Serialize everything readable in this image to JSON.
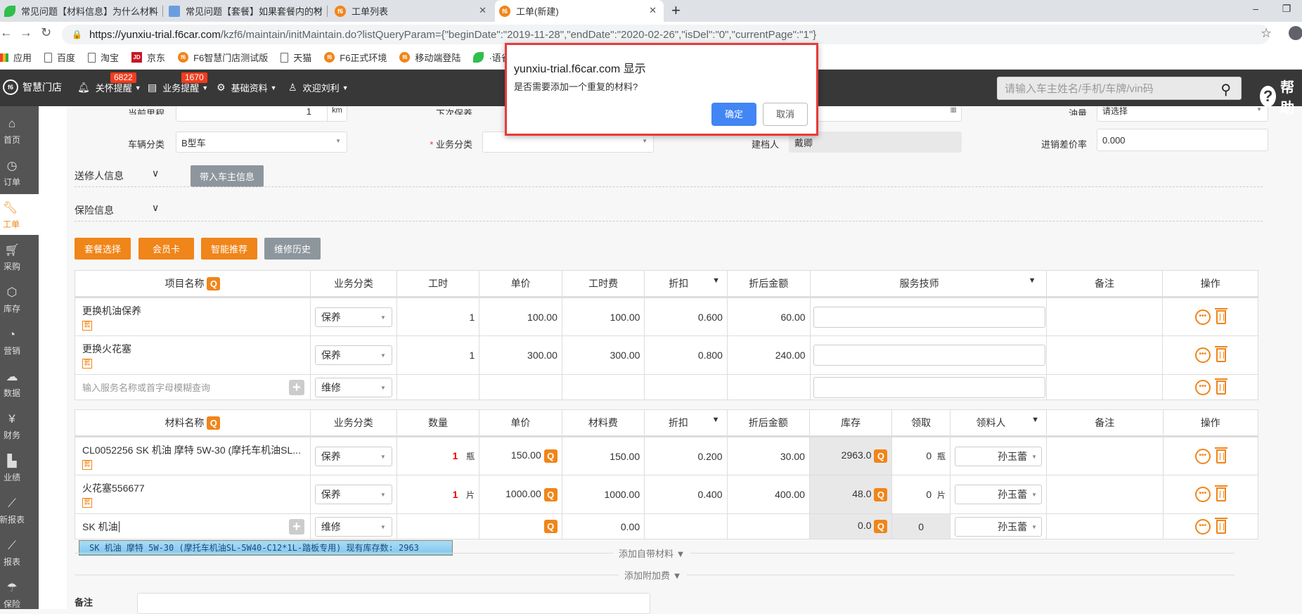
{
  "browser": {
    "tabs": [
      {
        "title": "常见问题【材料信息】为什么材料",
        "icon": "bird-icon"
      },
      {
        "title": "常见问题【套餐】如果套餐内的材",
        "icon": "doc-icon"
      },
      {
        "title": "工单列表",
        "icon": "f6-icon"
      },
      {
        "title": "工单(新建)",
        "icon": "f6-icon",
        "active": true
      }
    ],
    "new_tab": "+",
    "url_host": "https://yunxiu-trial.f6car.com",
    "url_rest": "/kzf6/maintain/initMaintain.do?listQueryParam={\"beginDate\":\"2019-11-28\",\"endDate\":\"2020-02-26\",\"isDel\":\"0\",\"currentPage\":\"1\"}",
    "bookmarks": [
      {
        "label": "应用",
        "icon": "apps"
      },
      {
        "label": "百度",
        "icon": "page"
      },
      {
        "label": "淘宝",
        "icon": "page"
      },
      {
        "label": "京东",
        "icon": "jd"
      },
      {
        "label": "F6智慧门店测试版",
        "icon": "f6"
      },
      {
        "label": "天猫",
        "icon": "page"
      },
      {
        "label": "F6正式环境",
        "icon": "f6"
      },
      {
        "label": "移动端登陆",
        "icon": "f6"
      },
      {
        "label": "·语雀数",
        "icon": "bird"
      }
    ]
  },
  "nav": {
    "logo": "智慧门店",
    "items": [
      {
        "label": "关怀提醒",
        "badge": "6822"
      },
      {
        "label": "业务提醒",
        "badge": "1670"
      },
      {
        "label": "基础资料"
      },
      {
        "label": "欢迎刘利"
      }
    ],
    "search_placeholder": "请输入车主姓名/手机/车牌/vin码",
    "help": "帮助"
  },
  "sidebar": [
    {
      "label": "首页",
      "icon": "home-icon"
    },
    {
      "label": "订单",
      "icon": "history-icon"
    },
    {
      "label": "工单",
      "icon": "wrench-icon",
      "active": true
    },
    {
      "label": "采购",
      "icon": "cart-icon"
    },
    {
      "label": "库存",
      "icon": "box-icon"
    },
    {
      "label": "营销",
      "icon": "pie-icon"
    },
    {
      "label": "数据",
      "icon": "cloud-icon"
    },
    {
      "label": "财务",
      "icon": "yuan-icon"
    },
    {
      "label": "业绩",
      "icon": "bar-chart-icon"
    },
    {
      "label": "新报表",
      "icon": "line-chart-icon"
    },
    {
      "label": "报表",
      "icon": "line-chart-icon"
    },
    {
      "label": "保险",
      "icon": "umbrella-icon"
    }
  ],
  "form": {
    "mileage_label": "当前里程",
    "mileage_value": "1",
    "mileage_unit": "km",
    "next_service_label": "下次保养",
    "oil_label": "油量",
    "oil_value": "请选择",
    "vehicle_class_label": "车辆分类",
    "vehicle_class_value": "B型车",
    "business_class_label": "业务分类",
    "business_class_value": "",
    "creator_label": "建档人",
    "creator_value": "戴卿",
    "margin_label": "进销差价率",
    "margin_value": "0.000",
    "sender_section": "送修人信息",
    "bring_owner_button": "带入车主信息",
    "insurance_section": "保险信息"
  },
  "actions": [
    "套餐选择",
    "会员卡",
    "智能推荐",
    "维修历史"
  ],
  "services": {
    "headers": [
      "项目名称",
      "业务分类",
      "工时",
      "单价",
      "工时费",
      "折扣",
      "折后金额",
      "服务技师",
      "备注",
      "操作"
    ],
    "rows": [
      {
        "name": "更换机油保养",
        "tag": "套",
        "category": "保养",
        "hours": "1",
        "price": "100.00",
        "fee": "100.00",
        "discount": "0.600",
        "amount": "60.00"
      },
      {
        "name": "更换火花塞",
        "tag": "套",
        "category": "保养",
        "hours": "1",
        "price": "300.00",
        "fee": "300.00",
        "discount": "0.800",
        "amount": "240.00"
      }
    ],
    "new_row_placeholder": "输入服务名称或首字母模糊查询",
    "new_row_category": "维修"
  },
  "materials": {
    "headers": [
      "材料名称",
      "业务分类",
      "数量",
      "单价",
      "材料费",
      "折扣",
      "折后金额",
      "库存",
      "领取",
      "领料人",
      "备注",
      "操作"
    ],
    "rows": [
      {
        "name": "CL0052256 SK 机油 摩特 5W-30 (摩托车机油SL...",
        "tag": "套",
        "category": "保养",
        "qty": "1",
        "unit": "瓶",
        "price": "150.00",
        "fee": "150.00",
        "discount": "0.200",
        "amount": "30.00",
        "stock": "2963.0",
        "taken": "0",
        "taken_unit": "瓶",
        "picker": "孙玉蕾"
      },
      {
        "name": "火花塞556677",
        "tag": "套",
        "category": "保养",
        "qty": "1",
        "unit": "片",
        "price": "1000.00",
        "fee": "1000.00",
        "discount": "0.400",
        "amount": "400.00",
        "stock": "48.0",
        "taken": "0",
        "taken_unit": "片",
        "picker": "孙玉蕾"
      }
    ],
    "new_row_input": "SK 机油",
    "new_row_category": "维修",
    "new_row_fee": "0.00",
    "new_row_stock": "0.0",
    "new_row_taken": "0",
    "new_row_picker": "孙玉蕾",
    "suggestion": "SK 机油 摩特 5W-30 (摩托车机油SL-5W40-C12*1L-踏板专用) 现有库存数: 2963"
  },
  "add_own_material": "添加自带材料 ▼",
  "add_extra_fee": "添加附加费 ▼",
  "remarks_label": "备注",
  "dialog": {
    "title": "yunxiu-trial.f6car.com 显示",
    "message": "是否需要添加一个重复的材料?",
    "ok": "确定",
    "cancel": "取消"
  }
}
